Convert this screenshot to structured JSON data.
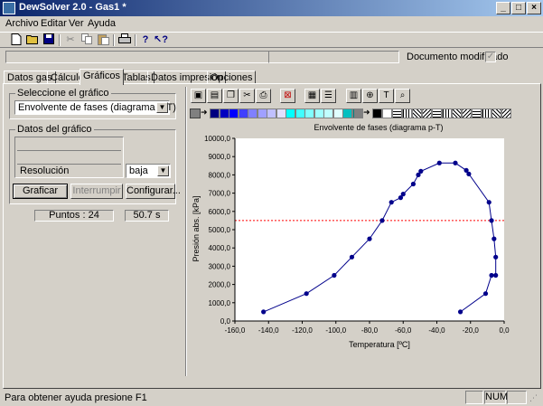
{
  "window": {
    "title": "DewSolver 2.0 - Gas1 *",
    "min": "_",
    "max": "□",
    "close": "×"
  },
  "menu": {
    "archivo": "Archivo",
    "editar": "Editar",
    "ver": "Ver",
    "ayuda": "Ayuda"
  },
  "status_top": {
    "documento_modificado": "Documento modificado"
  },
  "tabs": [
    "Datos gas",
    "Cálculo",
    "Gráficos",
    "Tablas",
    "Datos impresión",
    "Opciones"
  ],
  "left": {
    "select_group_label": "Seleccione el gráfico",
    "chart_select_value": "Envolvente de fases (diagrama p-T)",
    "data_group_label": "Datos del gráfico",
    "resolucion_label": "Resolución",
    "resolucion_value": "baja",
    "graficar": "Graficar",
    "interrumpir": "Interrumpir",
    "configurar": "Configurar...",
    "puntos": "Puntos : 24",
    "tiempo": "50.7  s"
  },
  "statusbar": {
    "help": "Para obtener ayuda presione F1",
    "num": "NUM"
  },
  "icons": {
    "toolbar": [
      "new-file-icon",
      "open-folder-icon",
      "save-icon",
      "cut-icon",
      "copy-icon",
      "paste-icon",
      "print-icon",
      "help-icon",
      "context-help-icon"
    ],
    "chart_toolbar": [
      "save-chart-icon",
      "export-chart-icon",
      "copy-chart-icon",
      "cut-chart-icon",
      "print-chart-icon",
      "series-color-icon",
      "grid-icon",
      "table-icon",
      "data-icon",
      "zoom-icon",
      "text-tool-icon",
      "magnifier-icon"
    ]
  },
  "swatch_colors": [
    "#000080",
    "#0000c0",
    "#0000ff",
    "#4040ff",
    "#8080ff",
    "#a0a0ff",
    "#c0c0ff",
    "#e0e0ff",
    "#00ffff",
    "#40ffff",
    "#80ffff",
    "#a0ffff",
    "#c0ffff",
    "#e0ffff",
    "#00c0c0",
    "#008080"
  ],
  "chart_data": {
    "type": "line",
    "title": "Envolvente de fases (diagrama p-T)",
    "xlabel": "Temperatura  [ºC]",
    "ylabel": "Presión abs.  [kPa]",
    "xlim": [
      -160,
      0
    ],
    "ylim": [
      0,
      10000
    ],
    "xticks": [
      "-160,0",
      "-140,0",
      "-120,0",
      "-100,0",
      "-80,0",
      "-60,0",
      "-40,0",
      "-20,0",
      "0,0"
    ],
    "yticks": [
      "0,0",
      "1000,0",
      "2000,0",
      "3000,0",
      "4000,0",
      "5000,0",
      "6000,0",
      "7000,0",
      "8000,0",
      "9000,0",
      "10000,0"
    ],
    "reference_line_y": 5500,
    "colors": {
      "series": "#00008b",
      "reference": "#ff0000",
      "plot_bg": "#ffffff"
    },
    "series": [
      {
        "x": [
          -143,
          -117.5,
          -101,
          -90.5,
          -80,
          -72.5,
          -67,
          -61.5,
          -60,
          -54,
          -51,
          -49.5,
          -38.5,
          -29,
          -22.5,
          -21,
          -9,
          -7.5,
          -6,
          -5,
          -5,
          -7.5,
          -11,
          -26
        ],
        "y": [
          500,
          1500,
          2500,
          3500,
          4500,
          5500,
          6500,
          6750,
          6950,
          7500,
          8000,
          8200,
          8650,
          8650,
          8250,
          8050,
          6500,
          5500,
          4500,
          3500,
          2500,
          2500,
          1500,
          500
        ]
      }
    ]
  }
}
